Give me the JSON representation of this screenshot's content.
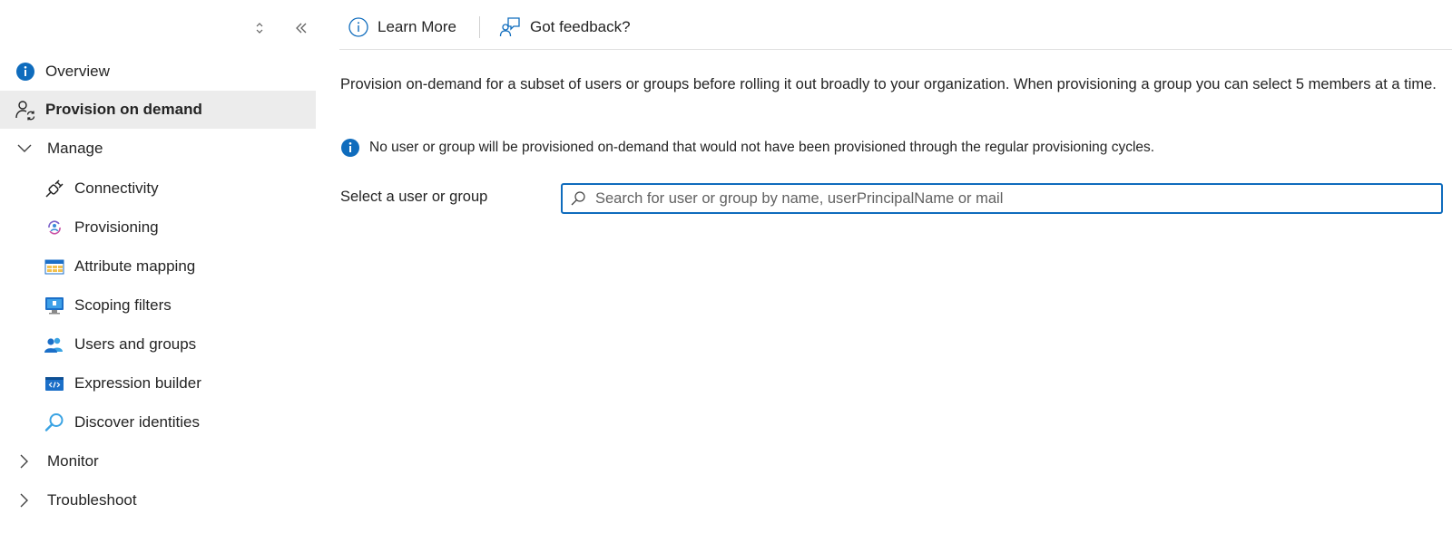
{
  "sidebar": {
    "items": [
      {
        "label": "Overview",
        "icon": "info-icon"
      },
      {
        "label": "Provision on demand",
        "icon": "person-sync-icon",
        "selected": true
      },
      {
        "label": "Manage",
        "icon": "chevron-down-icon",
        "expanded": true
      },
      {
        "label": "Connectivity",
        "icon": "plug-icon"
      },
      {
        "label": "Provisioning",
        "icon": "provisioning-icon"
      },
      {
        "label": "Attribute mapping",
        "icon": "table-icon"
      },
      {
        "label": "Scoping filters",
        "icon": "monitor-icon"
      },
      {
        "label": "Users and groups",
        "icon": "users-icon"
      },
      {
        "label": "Expression builder",
        "icon": "code-icon"
      },
      {
        "label": "Discover identities",
        "icon": "search-icon"
      },
      {
        "label": "Monitor",
        "icon": "chevron-right-icon",
        "expanded": false
      },
      {
        "label": "Troubleshoot",
        "icon": "chevron-right-icon",
        "expanded": false
      }
    ]
  },
  "toolbar": {
    "learn_more": "Learn More",
    "feedback": "Got feedback?"
  },
  "main": {
    "description": "Provision on-demand for a subset of users or groups before rolling it out broadly to your organization. When provisioning a group you can select 5 members at a time.",
    "notice": "No user or group will be provisioned on-demand that would not have been provisioned through the regular provisioning cycles.",
    "select_label": "Select a user or group",
    "search_placeholder": "Search for user or group by name, userPrincipalName or mail",
    "search_value": ""
  },
  "colors": {
    "accent": "#0f6cbd",
    "selected_bg": "#ececec",
    "info_blue": "#0f6cbd"
  }
}
